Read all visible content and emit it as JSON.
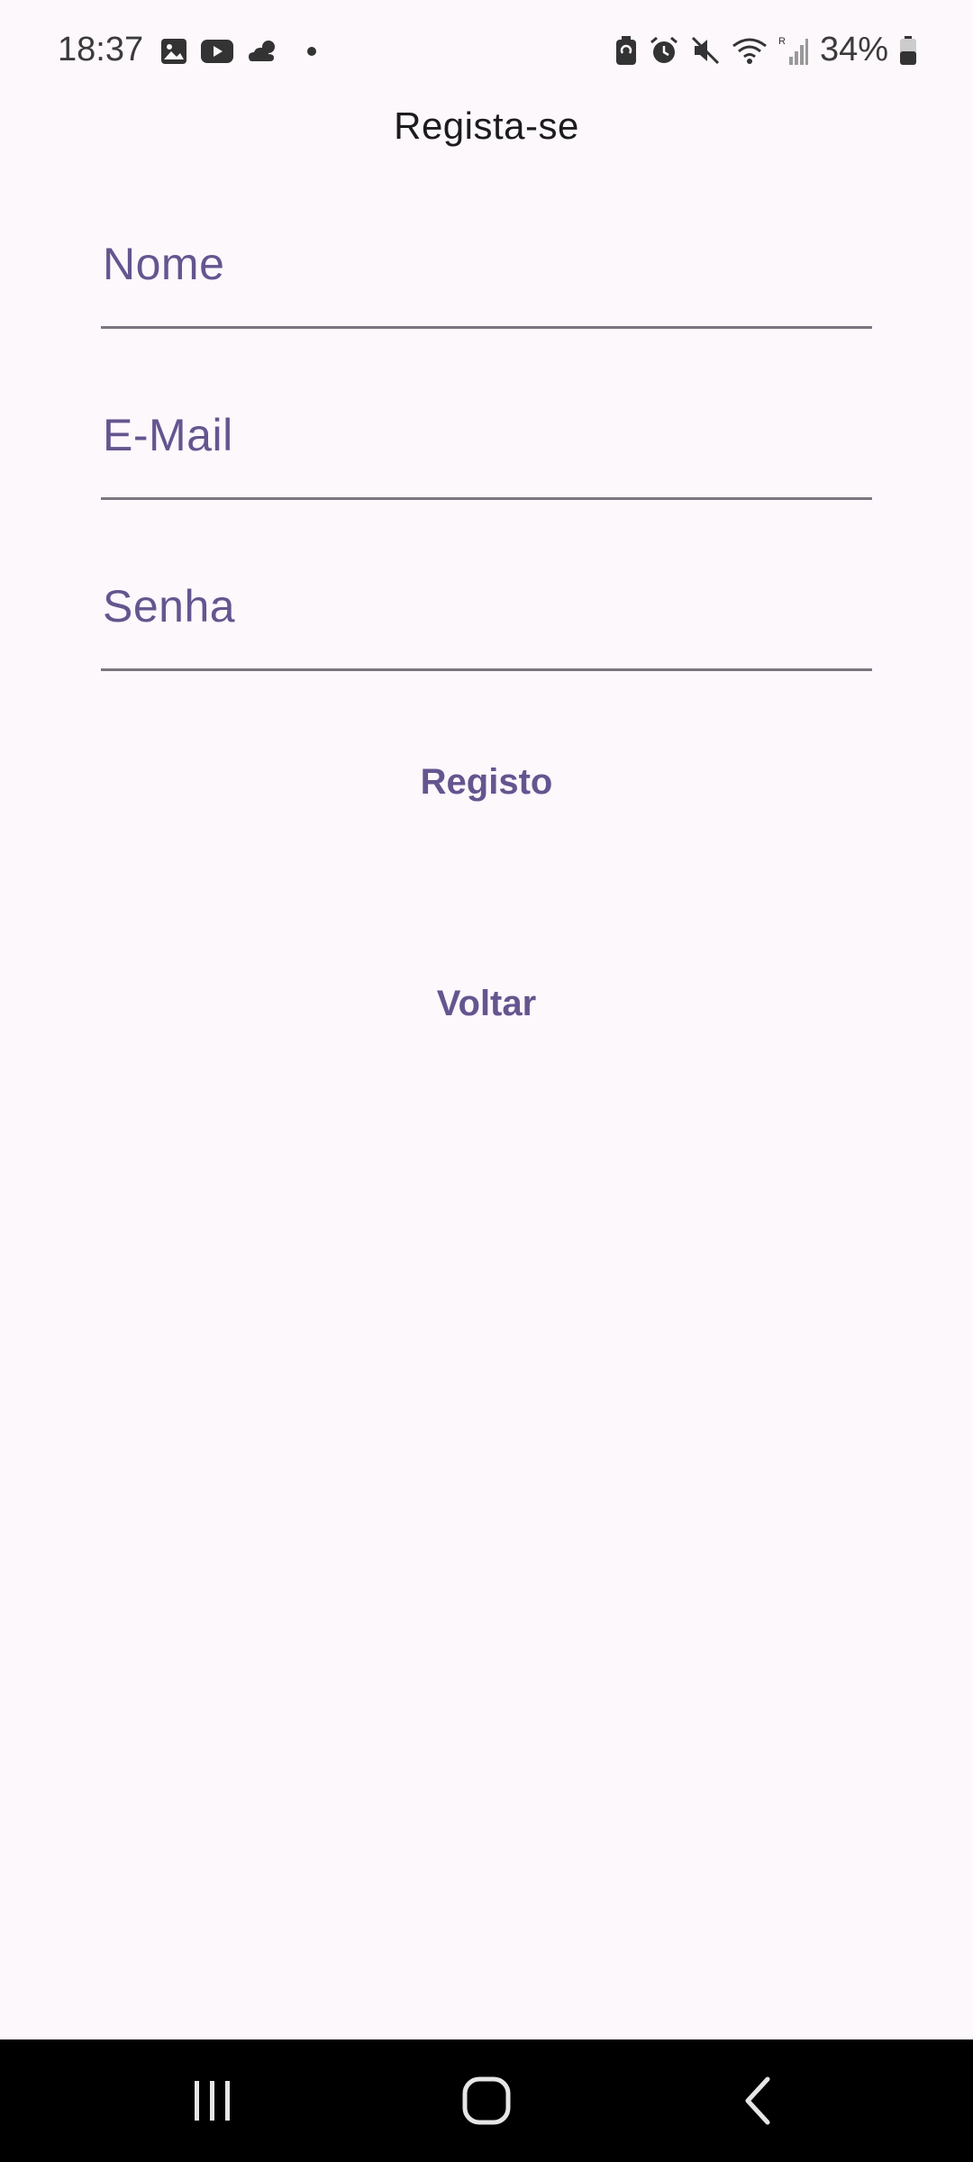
{
  "status_bar": {
    "time": "18:37",
    "battery_percent": "34%",
    "left_icons": [
      "gallery-icon",
      "youtube-icon",
      "weather-icon",
      "dot-icon"
    ],
    "right_icons": [
      "battery-saver-icon",
      "alarm-icon",
      "mute-icon",
      "wifi-icon",
      "signal-icon",
      "battery-icon"
    ]
  },
  "header": {
    "title": "Regista-se"
  },
  "form": {
    "name_label": "Nome",
    "email_label": "E-Mail",
    "password_label": "Senha"
  },
  "actions": {
    "register_label": "Registo",
    "back_label": "Voltar"
  },
  "nav_bar": {
    "icons": [
      "recent-apps-icon",
      "home-icon",
      "back-icon"
    ]
  },
  "colors": {
    "background": "#fdf8fc",
    "accent": "#65558f",
    "underline": "#7b7680",
    "nav_bar": "#000000"
  }
}
